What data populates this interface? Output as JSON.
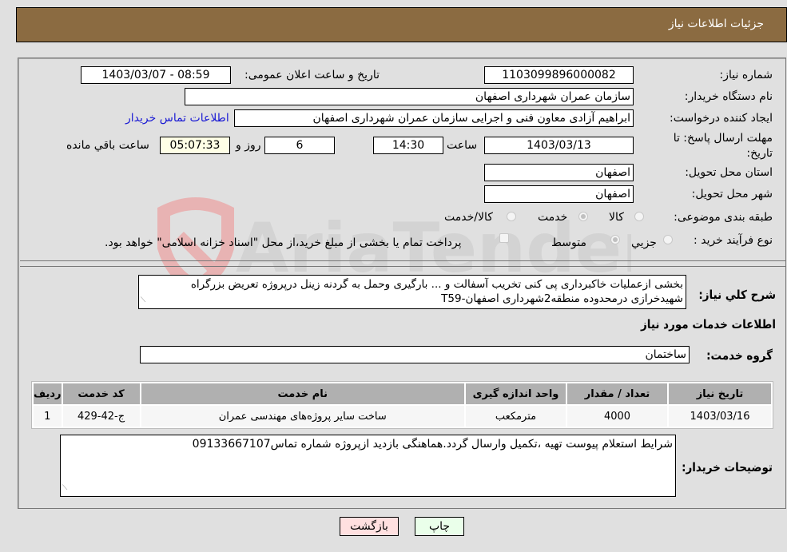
{
  "header": {
    "title": "جزئیات اطلاعات نیاز"
  },
  "fields": {
    "need_number": {
      "label": "شماره نیاز:",
      "value": "1103099896000082"
    },
    "announce_datetime": {
      "label": "تاریخ و ساعت اعلان عمومی:",
      "value": "1403/03/07 - 08:59"
    },
    "buyer_org": {
      "label": "نام دستگاه خریدار:",
      "value": "سازمان عمران شهرداری اصفهان"
    },
    "requester": {
      "label": "ایجاد کننده درخواست:",
      "value": "ابراهیم آزادی معاون فنی و اجرایی سازمان عمران شهرداری اصفهان"
    },
    "buyer_contact_link": "اطلاعات تماس خریدار",
    "deadline": {
      "label_line1": "مهلت ارسال پاسخ: تا",
      "label_line2": "تاریخ:",
      "date": "1403/03/13",
      "time_label": "ساعت",
      "time": "14:30",
      "days": "6",
      "days_label": "روز و",
      "remaining": "05:07:33",
      "remaining_label": "ساعت باقي مانده"
    },
    "province": {
      "label": "استان محل تحویل:",
      "value": "اصفهان"
    },
    "city": {
      "label": "شهر محل تحویل:",
      "value": "اصفهان"
    },
    "category": {
      "label": "طبقه بندی موضوعی:",
      "options": [
        "کالا",
        "خدمت",
        "کالا/خدمت"
      ],
      "selected": "خدمت"
    },
    "purchase_type": {
      "label": "نوع فرآیند خرید :",
      "options": [
        "جزيي",
        "متوسط"
      ],
      "selected": "متوسط",
      "payment_note": "پرداخت تمام یا بخشی از مبلغ خرید،از محل \"اسناد خزانه اسلامی\" خواهد بود."
    }
  },
  "description": {
    "label": "شرح کلي نياز:",
    "value": "بخشی ازعملیات خاکبرداری پی کنی تخریب آسفالت و ...  بارگیری وحمل به گردنه زینل درپروژه تعریض بزرگراه شهیدخرازی درمحدوده منطقه2شهرداری اصفهان-T59"
  },
  "services": {
    "section_title": "اطلاعات خدمات مورد نیاز",
    "group_label": "گروه خدمت:",
    "group_value": "ساختمان",
    "columns": [
      "ردیف",
      "کد خدمت",
      "نام خدمت",
      "واحد اندازه گیری",
      "تعداد / مقدار",
      "تاریخ نیاز"
    ],
    "rows": [
      [
        "1",
        "ج-42-429",
        "ساخت سایر پروژه‌های مهندسی عمران",
        "مترمکعب",
        "4000",
        "1403/03/16"
      ]
    ]
  },
  "buyer_notes": {
    "label": "توضیحات خریدار:",
    "value": "شرایط استعلام پیوست تهیه ،تکمیل وارسال گردد.هماهنگی بازدید ازپروژه شماره تماس09133667107"
  },
  "buttons": {
    "print": "چاپ",
    "back": "بازگشت"
  },
  "watermark": {
    "text": "AriaTender.neT"
  },
  "colors": {
    "header_bg": "#8b6b41",
    "back_btn_bg": "#ffe0e0",
    "print_btn_bg": "#eaffea",
    "link": "#1a1ad4"
  }
}
